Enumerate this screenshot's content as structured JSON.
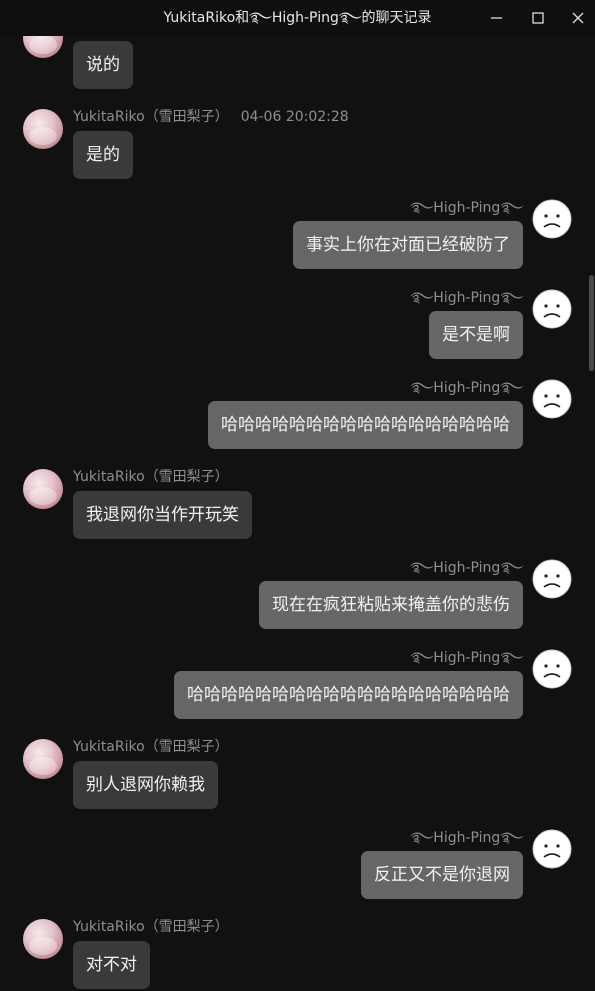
{
  "window": {
    "title": "YukitaRiko和࿐High-Ping࿐的聊天记录",
    "minimize_icon": "minimize-icon",
    "maximize_icon": "maximize-icon",
    "close_icon": "close-icon"
  },
  "contacts": {
    "left_name": "YukitaRiko（雪田梨子）",
    "right_name": "࿐High-Ping࿐"
  },
  "messages": [
    {
      "side": "left",
      "text": "说的",
      "time": ""
    },
    {
      "side": "left",
      "text": "是的",
      "time": "04-06 20:02:28"
    },
    {
      "side": "right",
      "text": "事实上你在对面已经破防了"
    },
    {
      "side": "right",
      "text": "是不是啊"
    },
    {
      "side": "right",
      "text": "哈哈哈哈哈哈哈哈哈哈哈哈哈哈哈哈哈"
    },
    {
      "side": "left",
      "text": "我退网你当作开玩笑",
      "time": ""
    },
    {
      "side": "right",
      "text": "现在在疯狂粘贴来掩盖你的悲伤"
    },
    {
      "side": "right",
      "text": "哈哈哈哈哈哈哈哈哈哈哈哈哈哈哈哈哈哈哈"
    },
    {
      "side": "left",
      "text": "别人退网你赖我",
      "time": ""
    },
    {
      "side": "right",
      "text": "反正又不是你退网"
    },
    {
      "side": "left",
      "text": "对不对",
      "time": ""
    }
  ],
  "colors": {
    "background": "#111111",
    "bubble_left": "#3a3a3a",
    "bubble_right": "#666666",
    "name_text": "#8f8f8f"
  }
}
